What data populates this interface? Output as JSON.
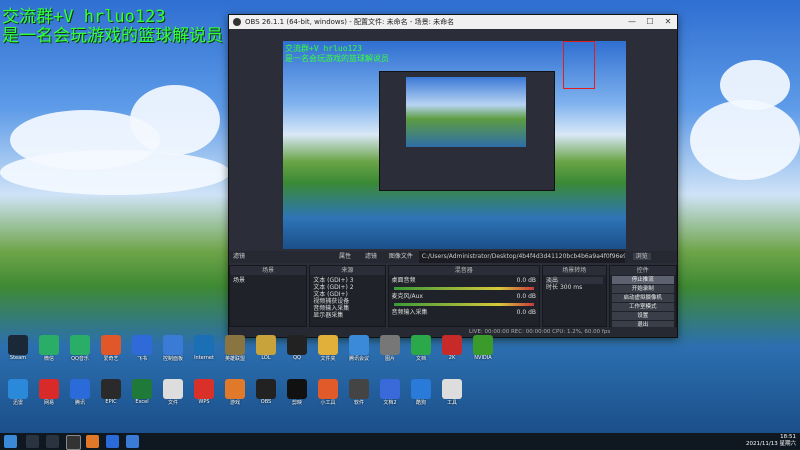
{
  "overlay": {
    "line1": "交流群+V hrluo123",
    "line2": "是一名会玩游戏的篮球解说员"
  },
  "obs": {
    "title": "OBS 26.1.1 (64-bit, windows) - 配置文件: 未命名 - 场景: 未命名",
    "toolbar_left": "滤镜",
    "toolbar_props": "属性",
    "toolbar_filter": "滤镜",
    "image_file_label": "图像文件",
    "image_path": "C:/Users/Administrator/Desktop/4b4f4d3d41120bcb4b6a9a4f0f96e9d8.jpeg",
    "browse": "浏览",
    "docks": {
      "scenes": "场景",
      "sources": "来源",
      "mixer": "混音器",
      "transitions": "场景转场",
      "controls": "控件"
    },
    "scene_item": "场景",
    "sources": [
      "文本 (GDI+) 3",
      "文本 (GDI+) 2",
      "文本 (GDI+)",
      "视频捕获设备",
      "音频输入采集",
      "显示器采集"
    ],
    "mixer": [
      {
        "name": "桌面音频",
        "db": "0.0 dB"
      },
      {
        "name": "麦克风/Aux",
        "db": "0.0 dB"
      },
      {
        "name": "音频输入采集",
        "db": "0.0 dB"
      }
    ],
    "transition": {
      "type": "淡出",
      "duration_label": "时长",
      "duration": "300 ms"
    },
    "controls": [
      "停止推流",
      "开始录制",
      "启动虚拟摄像机",
      "工作室模式",
      "设置",
      "退出"
    ],
    "status": "LIVE: 00:00:00   REC: 00:00:00   CPU: 1.2%, 60.00 fps"
  },
  "desktop_icons": [
    {
      "label": "Steam",
      "color": "#1b2838"
    },
    {
      "label": "微信",
      "color": "#2aae67"
    },
    {
      "label": "QQ音乐",
      "color": "#2aae67"
    },
    {
      "label": "爱奇艺",
      "color": "#e0572a"
    },
    {
      "label": "飞书",
      "color": "#2e6bd9"
    },
    {
      "label": "控制面板",
      "color": "#3a7bd5"
    },
    {
      "label": "Internet",
      "color": "#1a6fb5"
    },
    {
      "label": "英雄联盟",
      "color": "#8a7440"
    },
    {
      "label": "LOL",
      "color": "#c8a23a"
    },
    {
      "label": "QQ",
      "color": "#222"
    },
    {
      "label": "文件夹",
      "color": "#e0b03a"
    },
    {
      "label": "腾讯会议",
      "color": "#3a8ad9"
    },
    {
      "label": "图片",
      "color": "#777"
    },
    {
      "label": "文档",
      "color": "#2aa84a"
    },
    {
      "label": "2K",
      "color": "#c82a2a"
    },
    {
      "label": "NVIDIA",
      "color": "#3a9a2a"
    },
    {
      "label": "迅雷",
      "color": "#2a8ad9"
    },
    {
      "label": "网易",
      "color": "#d92a2a"
    },
    {
      "label": "腾讯",
      "color": "#2a6ad9"
    },
    {
      "label": "EPIC",
      "color": "#2a2a2a"
    },
    {
      "label": "Excel",
      "color": "#1f7a3a"
    },
    {
      "label": "文件",
      "color": "#ddd"
    },
    {
      "label": "WPS",
      "color": "#d9302a"
    },
    {
      "label": "游戏",
      "color": "#e07a2a"
    },
    {
      "label": "OBS",
      "color": "#222"
    },
    {
      "label": "剪映",
      "color": "#111"
    },
    {
      "label": "小工具",
      "color": "#e05a2a"
    },
    {
      "label": "软件",
      "color": "#444"
    },
    {
      "label": "文档2",
      "color": "#3a6ad9"
    },
    {
      "label": "酷狗",
      "color": "#2a7ad9"
    },
    {
      "label": "工具",
      "color": "#ddd"
    }
  ],
  "clock": {
    "time": "18:51",
    "date": "2021/11/13 星期六"
  }
}
